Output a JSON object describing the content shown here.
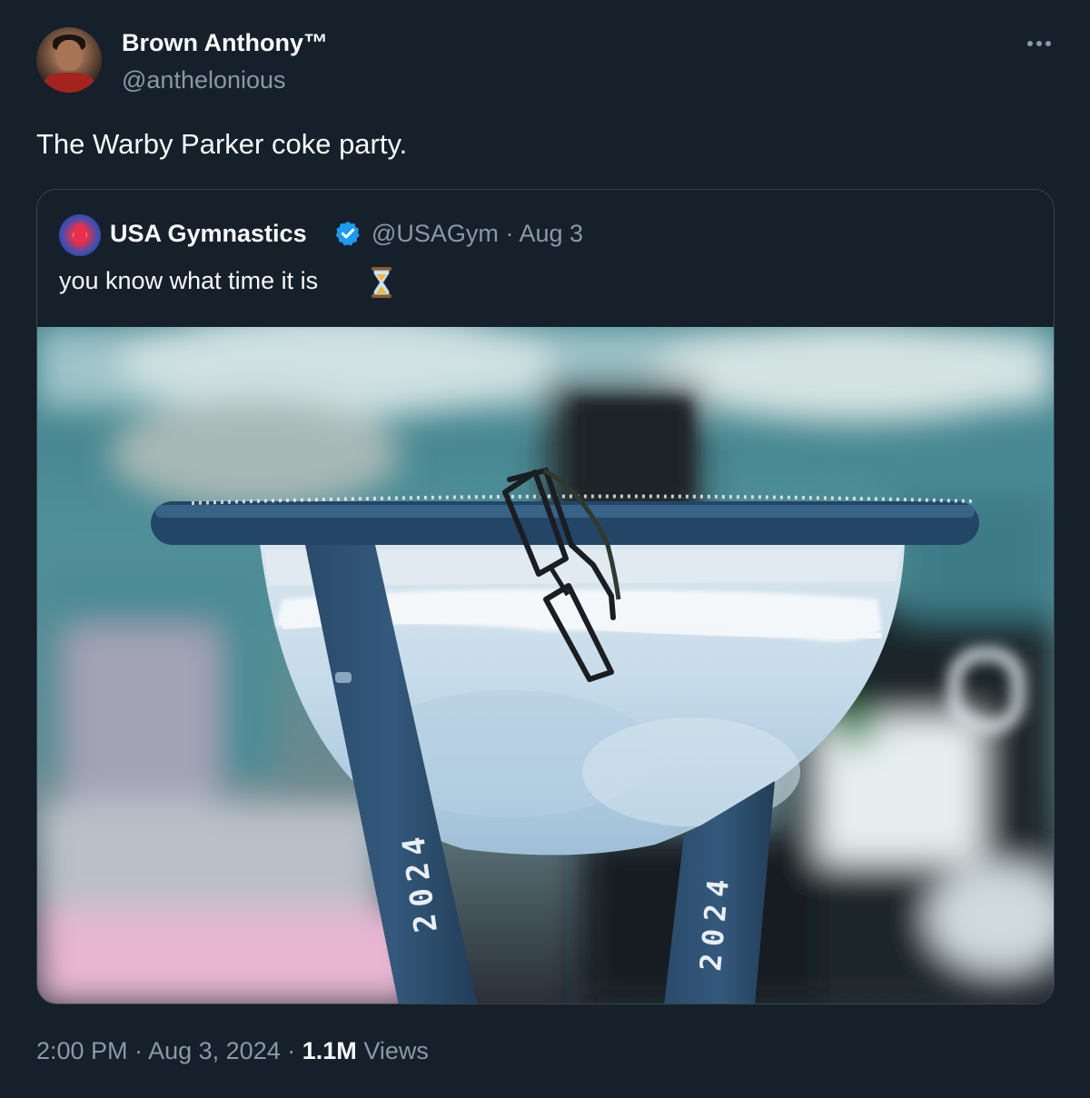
{
  "author": {
    "name": "Brown Anthony™",
    "handle": "@anthelonious",
    "avatar": "profile-photo"
  },
  "tweet": {
    "text": "The Warby Parker coke party."
  },
  "more_icon": "more-horizontal-icon",
  "quoted": {
    "name": "USA Gymnastics",
    "verified": true,
    "handle": "@USAGym",
    "separator": "·",
    "date": "Aug 3",
    "text": "you know what time it is",
    "emoji": "hourglass-icon",
    "photo_year_label": "2024"
  },
  "meta": {
    "time": "2:00 PM",
    "date": "Aug 3, 2024",
    "views_count": "1.1M",
    "views_label": "Views",
    "separator": "·"
  },
  "colors": {
    "background": "#15202b",
    "text_primary": "#f7f9f9",
    "text_secondary": "#8b98a5",
    "border": "#38444d",
    "verified_blue": "#1d9bf0"
  }
}
